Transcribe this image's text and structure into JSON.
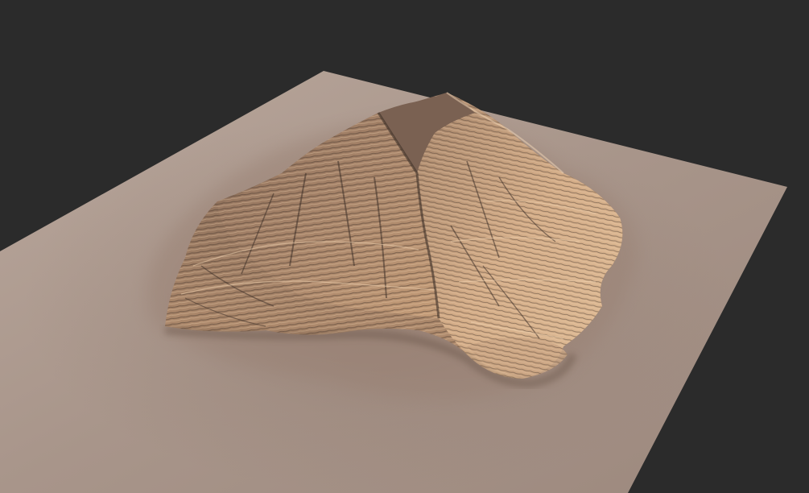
{
  "viewport": {
    "background": "#2b2b2b"
  },
  "terrain": {
    "ground_color": "#a8958a",
    "rock_light": "#d9b38f",
    "rock_mid": "#b58d6c",
    "rock_dark": "#5e4a3e",
    "shadow_color": "#3e3028"
  }
}
